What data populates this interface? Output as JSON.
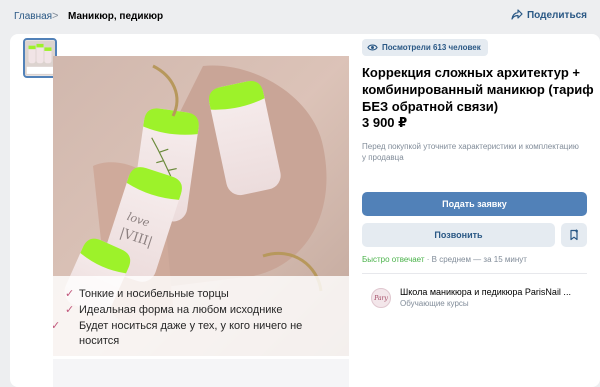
{
  "breadcrumb": {
    "home": "Главная",
    "separator": ">",
    "current": "Маникюр, педикюр"
  },
  "share": {
    "label": "Поделиться",
    "icon": "share-icon"
  },
  "product": {
    "views": "Посмотрели 613 человек",
    "title": "Коррекция сложных архитектур + комбинированный маникюр (тариф БЕЗ обратной связи)",
    "price": "3 900 ₽",
    "note": "Перед покупкой уточните характеристики и комплектацию у продавца"
  },
  "image": {
    "bullets": [
      "Тонкие и носибельные торцы",
      "Идеальная форма на любом исходнике",
      "Будет носиться даже у тех, у кого ничего не носится"
    ],
    "check_mark": "✓",
    "accent": "#c1587c",
    "nail_accent": "#9df22a"
  },
  "actions": {
    "apply": "Подать заявку",
    "call": "Позвонить",
    "save_icon": "bookmark-icon"
  },
  "response": {
    "fast": "Быстро отвечает",
    "sep": " · ",
    "avg": "В среднем — за 15 минут"
  },
  "seller": {
    "avatar_text": "Pary",
    "name": "Школа маникюра и педикюра ParisNail ...",
    "category": "Обучающие курсы"
  },
  "colors": {
    "link": "#2a5885",
    "primary_button": "#5181b8",
    "secondary_button": "#e5ebf1",
    "fast_green": "#4bb34b"
  }
}
